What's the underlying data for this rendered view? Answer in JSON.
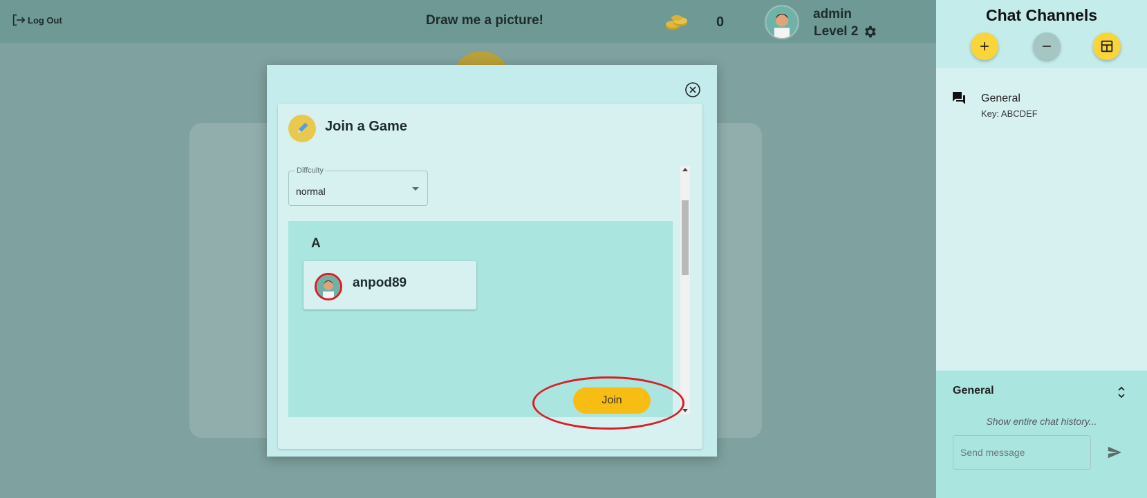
{
  "header": {
    "logout_label": "Log Out",
    "app_title": "Draw me a picture!",
    "coin_count": "0",
    "user": {
      "name": "admin",
      "level": "Level 2"
    }
  },
  "modal": {
    "title": "Join a Game",
    "difficulty": {
      "label": "Diffculty",
      "value": "normal"
    },
    "groups": [
      {
        "letter": "A",
        "players": [
          {
            "name": "anpod89"
          }
        ],
        "join_label": "Join"
      }
    ]
  },
  "sidebar": {
    "title": "Chat Channels",
    "channels": [
      {
        "name": "General",
        "key": "Key: ABCDEF"
      }
    ],
    "chat": {
      "active_channel": "General",
      "history_link": "Show entire chat history...",
      "input_placeholder": "Send message"
    }
  },
  "colors": {
    "accent_yellow": "#f7bd13",
    "teal_panel": "#aae5df",
    "highlight_red": "#d81e27"
  },
  "icons": [
    "logout-icon",
    "coins-icon",
    "gear-icon",
    "close-icon",
    "pencil-icon",
    "chevron-down-icon",
    "chat-icon",
    "plus-icon",
    "minus-icon",
    "layout-icon",
    "expand-icon",
    "send-icon"
  ]
}
